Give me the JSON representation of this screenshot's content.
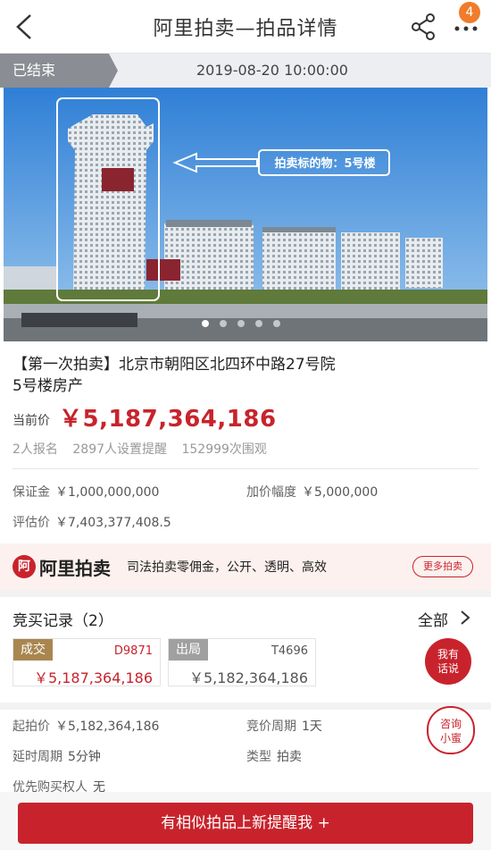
{
  "header": {
    "title": "阿里拍卖—拍品详情",
    "notification_count": "4"
  },
  "status": {
    "state": "已结束",
    "end_time": "2019-08-20 10:00:00"
  },
  "photo": {
    "annotation": "拍卖标的物：5号楼"
  },
  "lot": {
    "title_line1": "【第一次拍卖】北京市朝阳区北四环中路27号院",
    "title_line2": "5号楼房产",
    "price_label": "当前价",
    "price": "￥5,187,364,186",
    "stats": {
      "registered": "2人报名",
      "reminders": "2897人设置提醒",
      "views": "152999次围观"
    }
  },
  "details": {
    "deposit_label": "保证金",
    "deposit": "￥1,000,000,000",
    "increment_label": "加价幅度",
    "increment": "￥5,000,000",
    "appraisal_label": "评估价",
    "appraisal": "￥7,403,377,408.5"
  },
  "banner": {
    "logo_mark": "阿",
    "logo_text": "阿里拍卖",
    "slogan": "司法拍卖零佣金，公开、透明、高效",
    "more_label": "更多拍卖"
  },
  "bidding": {
    "title": "竞买记录（2）",
    "all_label": "全部",
    "records": [
      {
        "tag": "成交",
        "bidder": "D9871",
        "amount": "￥5,187,364,186",
        "tag_color": "#a9864f",
        "text_color": "#c8232c"
      },
      {
        "tag": "出局",
        "bidder": "T4696",
        "amount": "￥5,182,364,186",
        "tag_color": "#a0a0a0",
        "text_color": "#555555"
      }
    ],
    "chat_label_1": "我有",
    "chat_label_2": "话说",
    "consult_label_1": "咨询",
    "consult_label_2": "小蜜"
  },
  "terms": {
    "start_price_label": "起拍价",
    "start_price": "￥5,182,364,186",
    "cycle_label": "竞价周期",
    "cycle": "1天",
    "delay_label": "延时周期",
    "delay": "5分钟",
    "type_label": "类型",
    "type": "拍卖",
    "priority_label": "优先购买权人",
    "priority": "无"
  },
  "footer": {
    "button_label": "有相似拍品上新提醒我 +"
  },
  "colors": {
    "accent": "#c8232c",
    "badge": "#f07c2c"
  }
}
